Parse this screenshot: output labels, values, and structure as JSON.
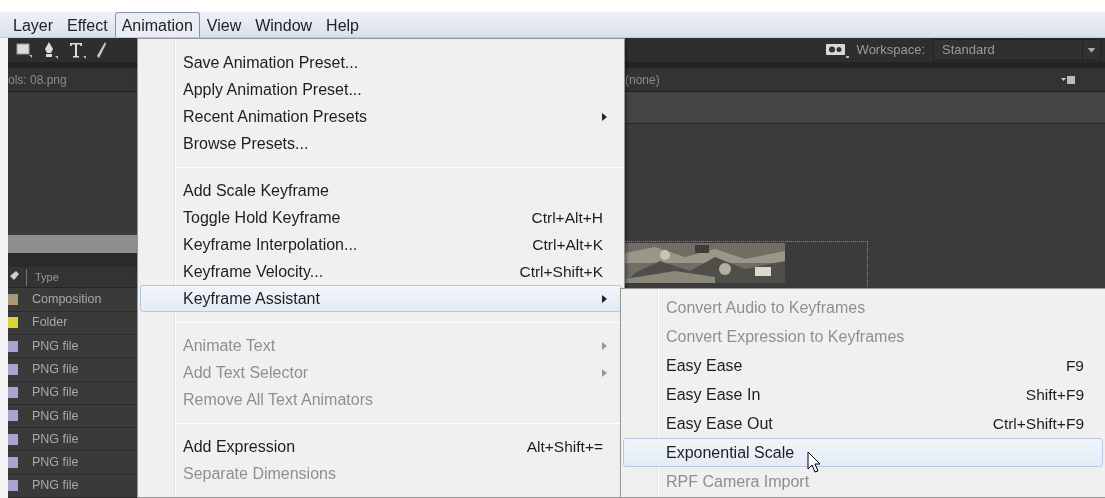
{
  "menubar": [
    {
      "label": "Layer",
      "selected": false
    },
    {
      "label": "Effect",
      "selected": false
    },
    {
      "label": "Animation",
      "selected": true
    },
    {
      "label": "View",
      "selected": false
    },
    {
      "label": "Window",
      "selected": false
    },
    {
      "label": "Help",
      "selected": false
    }
  ],
  "workspace": {
    "label": "Workspace:",
    "value": "Standard"
  },
  "project_panel": {
    "tab": "ols: 08.png",
    "columns": [
      "Type"
    ],
    "rows": [
      {
        "type": "Composition",
        "color": "#a89878"
      },
      {
        "type": "Folder",
        "color": "#dcd43a"
      },
      {
        "type": "PNG file",
        "color": "#a9a3d2"
      },
      {
        "type": "PNG file",
        "color": "#a9a3d2"
      },
      {
        "type": "PNG file",
        "color": "#a9a3d2"
      },
      {
        "type": "PNG file",
        "color": "#a9a3d2"
      },
      {
        "type": "PNG file",
        "color": "#a9a3d2"
      },
      {
        "type": "PNG file",
        "color": "#a9a3d2"
      },
      {
        "type": "PNG file",
        "color": "#a9a3d2"
      }
    ]
  },
  "viewer_panel": {
    "tab": "(none)"
  },
  "animation_menu": {
    "items": [
      {
        "kind": "item",
        "label": "Save Animation Preset...",
        "disabled": false,
        "submenu": false,
        "selected": false
      },
      {
        "kind": "item",
        "label": "Apply Animation Preset...",
        "disabled": false,
        "submenu": false,
        "selected": false
      },
      {
        "kind": "item",
        "label": "Recent Animation Presets",
        "disabled": false,
        "submenu": true,
        "selected": false
      },
      {
        "kind": "item",
        "label": "Browse Presets...",
        "disabled": false,
        "submenu": false,
        "selected": false
      },
      {
        "kind": "separator"
      },
      {
        "kind": "item",
        "label": "Add Scale Keyframe",
        "disabled": false,
        "submenu": false,
        "selected": false
      },
      {
        "kind": "item",
        "label": "Toggle Hold Keyframe",
        "shortcut": "Ctrl+Alt+H",
        "disabled": false,
        "submenu": false,
        "selected": false
      },
      {
        "kind": "item",
        "label": "Keyframe Interpolation...",
        "shortcut": "Ctrl+Alt+K",
        "disabled": false,
        "submenu": false,
        "selected": false
      },
      {
        "kind": "item",
        "label": "Keyframe Velocity...",
        "shortcut": "Ctrl+Shift+K",
        "disabled": false,
        "submenu": false,
        "selected": false
      },
      {
        "kind": "item",
        "label": "Keyframe Assistant",
        "disabled": false,
        "submenu": true,
        "selected": true
      },
      {
        "kind": "separator"
      },
      {
        "kind": "item",
        "label": "Animate Text",
        "disabled": true,
        "submenu": true,
        "selected": false
      },
      {
        "kind": "item",
        "label": "Add Text Selector",
        "disabled": true,
        "submenu": true,
        "selected": false
      },
      {
        "kind": "item",
        "label": "Remove All Text Animators",
        "disabled": true,
        "submenu": false,
        "selected": false
      },
      {
        "kind": "separator"
      },
      {
        "kind": "item",
        "label": "Add Expression",
        "shortcut": "Alt+Shift+=",
        "disabled": false,
        "submenu": false,
        "selected": false
      },
      {
        "kind": "item",
        "label": "Separate Dimensions",
        "disabled": true,
        "submenu": false,
        "selected": false
      }
    ]
  },
  "keyframe_assistant_submenu": {
    "items": [
      {
        "label": "Convert Audio to Keyframes",
        "disabled": true,
        "selected": false
      },
      {
        "label": "Convert Expression to Keyframes",
        "disabled": true,
        "selected": false
      },
      {
        "label": "Easy Ease",
        "shortcut": "F9",
        "disabled": false,
        "selected": false
      },
      {
        "label": "Easy Ease In",
        "shortcut": "Shift+F9",
        "disabled": false,
        "selected": false
      },
      {
        "label": "Easy Ease Out",
        "shortcut": "Ctrl+Shift+F9",
        "disabled": false,
        "selected": false
      },
      {
        "label": "Exponential Scale",
        "disabled": false,
        "selected": true
      },
      {
        "label": "RPF Camera Import",
        "disabled": true,
        "selected": false
      }
    ]
  }
}
